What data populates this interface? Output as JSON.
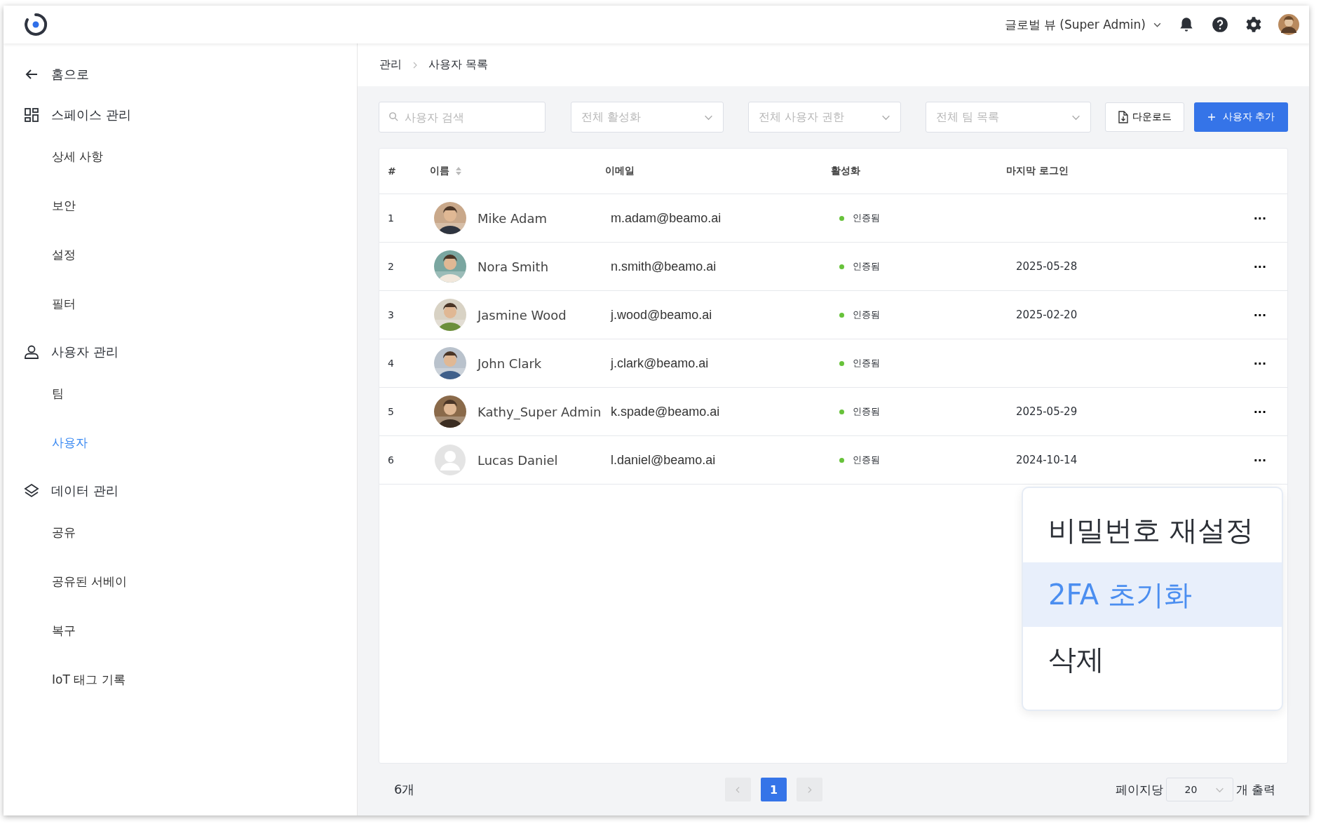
{
  "topbar": {
    "view_selector": "글로벌 뷰 (Super Admin)"
  },
  "sidebar": {
    "back": {
      "label": "홈으로"
    },
    "sections": [
      {
        "label": "스페이스 관리",
        "children": [
          {
            "label": "상세 사항",
            "selected": false
          },
          {
            "label": "보안",
            "selected": false
          },
          {
            "label": "설정",
            "selected": false
          },
          {
            "label": "필터",
            "selected": false
          }
        ]
      },
      {
        "label": "사용자 관리",
        "children": [
          {
            "label": "팀",
            "selected": false
          },
          {
            "label": "사용자",
            "selected": true
          }
        ]
      },
      {
        "label": "데이터 관리",
        "children": [
          {
            "label": "공유",
            "selected": false
          },
          {
            "label": "공유된 서베이",
            "selected": false
          },
          {
            "label": "복구",
            "selected": false
          },
          {
            "label": "IoT 태그 기록",
            "selected": false
          }
        ]
      }
    ]
  },
  "breadcrumb": [
    "관리",
    "사용자 목록"
  ],
  "toolbar": {
    "search": {
      "placeholder": "사용자 검색"
    },
    "filters": [
      {
        "placeholder": "전체 활성화"
      },
      {
        "placeholder": "전체 사용자 권한"
      },
      {
        "placeholder": "전체 팀 목록"
      }
    ],
    "download": "다운로드",
    "add": "사용자 추가"
  },
  "table": {
    "columns": [
      "#",
      "이름",
      "이메일",
      "활성화",
      "마지막 로그인"
    ],
    "rows": [
      {
        "index": "1",
        "name": "Mike Adam",
        "email": "m.adam@beamo.ai",
        "status": {
          "label": "인증됨",
          "color": "#67c23a"
        },
        "more": "···"
      },
      {
        "index": "2",
        "name": "Nora Smith",
        "email": "n.smith@beamo.ai",
        "status": {
          "label": "인증됨",
          "color": "#67c23a"
        },
        "last_login": "2025-05-28",
        "more": "···"
      },
      {
        "index": "3",
        "name": "Jasmine Wood",
        "email": "j.wood@beamo.ai",
        "status": {
          "label": "인증됨",
          "color": "#67c23a"
        },
        "last_login": "2025-02-20",
        "more": "···"
      },
      {
        "index": "4",
        "name": "John Clark",
        "email": "j.clark@beamo.ai",
        "status": {
          "label": "인증됨",
          "color": "#67c23a"
        },
        "more": "···"
      },
      {
        "index": "5",
        "name": "Kathy_Super Admin",
        "email": "k.spade@beamo.ai",
        "status": {
          "label": "인증됨",
          "color": "#67c23a"
        },
        "last_login": "2025-05-29",
        "more": "···"
      },
      {
        "index": "6",
        "avatar": {
          "kind": "placeholder"
        },
        "name": "Lucas Daniel",
        "email": "l.daniel@beamo.ai",
        "status": {
          "label": "인증됨",
          "color": "#67c23a"
        },
        "last_login": "2024-10-14",
        "more": "···"
      }
    ]
  },
  "context_menu": {
    "items": [
      {
        "label": "비밀번호 재설정",
        "selected": false
      },
      {
        "label": "2FA 초기화",
        "selected": true
      },
      {
        "label": "삭제",
        "selected": false
      }
    ]
  },
  "footer": {
    "total": "6개",
    "pages": [
      {
        "label": "1",
        "selected": true
      }
    ],
    "per_page_label": "페이지당",
    "per_page": "20",
    "per_page_suffix": "개 출력"
  }
}
